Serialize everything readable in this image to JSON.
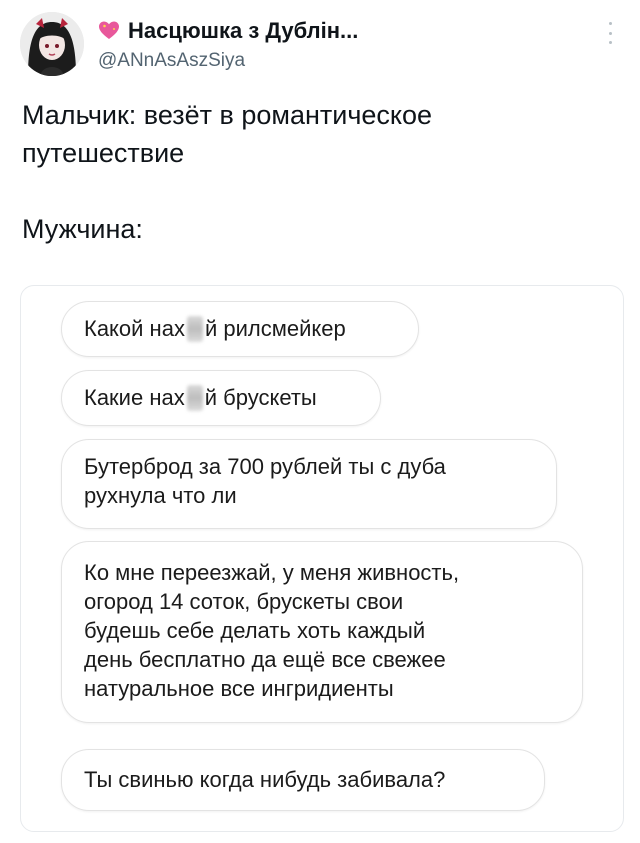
{
  "author": {
    "display_name": "Насцюшка з Дублін...",
    "handle": "@ANnAsAszSiya",
    "heart_icon": "sparkling-heart-icon",
    "avatar_icon": "avatar-illustration",
    "more_icon": "more-vertical-icon"
  },
  "tweet": {
    "lines": [
      "Мальчик: везёт в романтическое",
      "путешествие",
      "Мужчина:"
    ]
  },
  "chat": {
    "messages": [
      {
        "parts": [
          "Какой нах",
          "й рилсмейкер"
        ]
      },
      {
        "parts": [
          "Какие нах",
          "й брускеты"
        ]
      },
      {
        "lines": [
          "Бутерброд за 700 рублей ты с дуба",
          "рухнула что ли"
        ]
      },
      {
        "lines": [
          "Ко мне переезжай, у меня живность,",
          "огород 14 соток, брускеты свои",
          "будешь себе делать хоть каждый",
          "день бесплатно да ещё все свежее",
          "натуральное все ингридиенты"
        ]
      },
      {
        "lines": [
          "Ты свинью когда нибудь забивала?"
        ]
      }
    ]
  },
  "colors": {
    "handle": "#536471",
    "bubble_border": "#e3e3e3",
    "heart": "#e8589b"
  }
}
